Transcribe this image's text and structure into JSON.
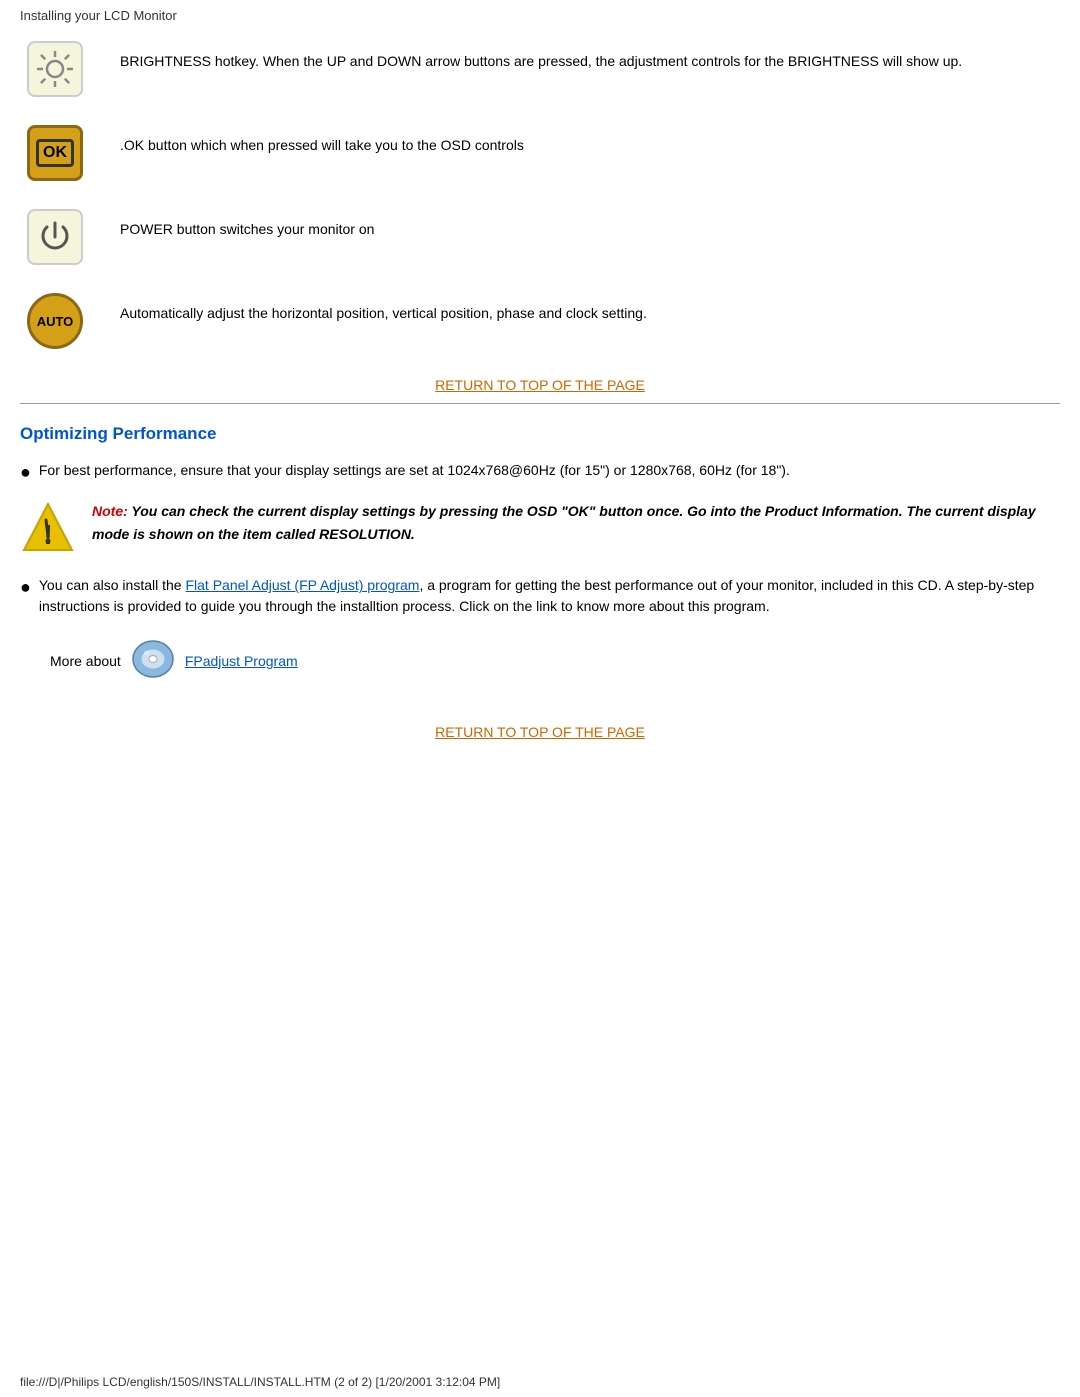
{
  "header": {
    "title": "Installing your LCD Monitor"
  },
  "icons_section": {
    "rows": [
      {
        "icon_type": "brightness",
        "icon_label": "☼",
        "description": "BRIGHTNESS hotkey. When the UP and DOWN arrow buttons are pressed, the adjustment controls for the BRIGHTNESS will show up."
      },
      {
        "icon_type": "ok",
        "icon_label": "OK",
        "description": ".OK button which when pressed will take you to the OSD controls"
      },
      {
        "icon_type": "power",
        "icon_label": "⏻",
        "description": "POWER button switches your monitor on"
      },
      {
        "icon_type": "auto",
        "icon_label": "AUTO",
        "description": "Automatically adjust the horizontal position, vertical position, phase and clock setting."
      }
    ],
    "return_link": "RETURN TO TOP OF THE PAGE"
  },
  "optimizing_section": {
    "title": "Optimizing Performance",
    "bullet1": "For best performance, ensure that your display settings are set at 1024x768@60Hz (for 15\") or 1280x768, 60Hz (for 18\").",
    "note_keyword": "Note:",
    "note_text": " You can check the current display settings by pressing the OSD \"OK\" button once. Go into the Product Information. The current display mode is shown on the item called RESOLUTION.",
    "bullet2_prefix": "You can also install the ",
    "bullet2_link_text": "Flat Panel Adjust (FP Adjust) program",
    "bullet2_suffix": ", a program for getting the best performance out of your monitor, included in this CD. A step-by-step instructions is provided to guide you through the installtion process. Click on the link to know more about this program.",
    "more_about_prefix": "More about",
    "more_about_link": "FPadjust Program",
    "return_link": "RETURN TO TOP OF THE PAGE"
  },
  "footer": {
    "text": "file:///D|/Philips LCD/english/150S/INSTALL/INSTALL.HTM (2 of 2) [1/20/2001 3:12:04 PM]"
  }
}
